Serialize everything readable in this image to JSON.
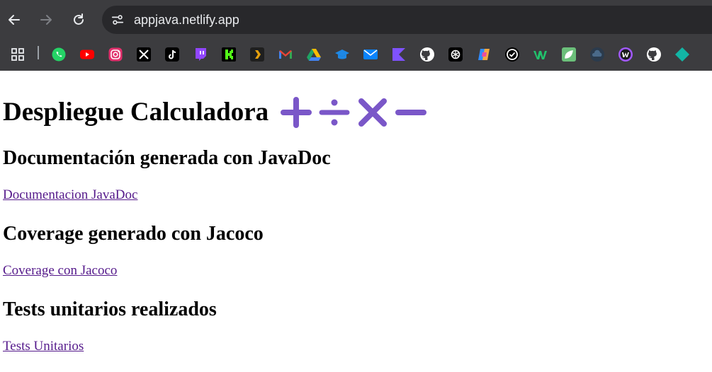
{
  "browser": {
    "url": "appjava.netlify.app",
    "bookmarks": [
      {
        "icon": "apps-grid-icon"
      },
      {
        "icon": "whatsapp-icon",
        "color": "#25d366"
      },
      {
        "icon": "youtube-icon",
        "color": "#ff0000"
      },
      {
        "icon": "instagram-icon",
        "color": "#e1306c"
      },
      {
        "icon": "x-icon",
        "color": "#000000"
      },
      {
        "icon": "tiktok-icon",
        "color": "#000000"
      },
      {
        "icon": "twitch-icon",
        "color": "#9146ff"
      },
      {
        "icon": "kick-icon",
        "color": "#53fc18"
      },
      {
        "icon": "plex-icon",
        "color": "#e5a00d"
      },
      {
        "icon": "gmail-icon",
        "color": "#ea4335"
      },
      {
        "icon": "google-drive-icon",
        "color": "#1fa463"
      },
      {
        "icon": "classroom-icon",
        "color": "#1e88e5"
      },
      {
        "icon": "mail-icon",
        "color": "#0a84ff"
      },
      {
        "icon": "kotlin-icon",
        "color": "#7f52ff"
      },
      {
        "icon": "github-icon",
        "color": "#ffffff"
      },
      {
        "icon": "chatgpt-icon",
        "color": "#ffffff"
      },
      {
        "icon": "copilot-icon",
        "color": "#f4a742"
      },
      {
        "icon": "check-circle-icon",
        "color": "#ffffff"
      },
      {
        "icon": "w-logo-icon",
        "color": "#21c36c"
      },
      {
        "icon": "leaf-icon",
        "color": "#6bbf7a"
      },
      {
        "icon": "cloud-icon",
        "color": "#4a6a8a"
      },
      {
        "icon": "w-circle-icon",
        "color": "#a259ff"
      },
      {
        "icon": "github-icon",
        "color": "#ffffff"
      },
      {
        "icon": "diamond-icon",
        "color": "#12b5a5"
      }
    ]
  },
  "page": {
    "title": "Despliegue Calculadora",
    "operator_color": "#7a57c8",
    "sections": [
      {
        "heading": "Documentación generada con JavaDoc",
        "link": "Documentacion JavaDoc"
      },
      {
        "heading": "Coverage generado con Jacoco",
        "link": "Coverage con Jacoco"
      },
      {
        "heading": "Tests unitarios realizados",
        "link": "Tests Unitarios"
      }
    ]
  }
}
